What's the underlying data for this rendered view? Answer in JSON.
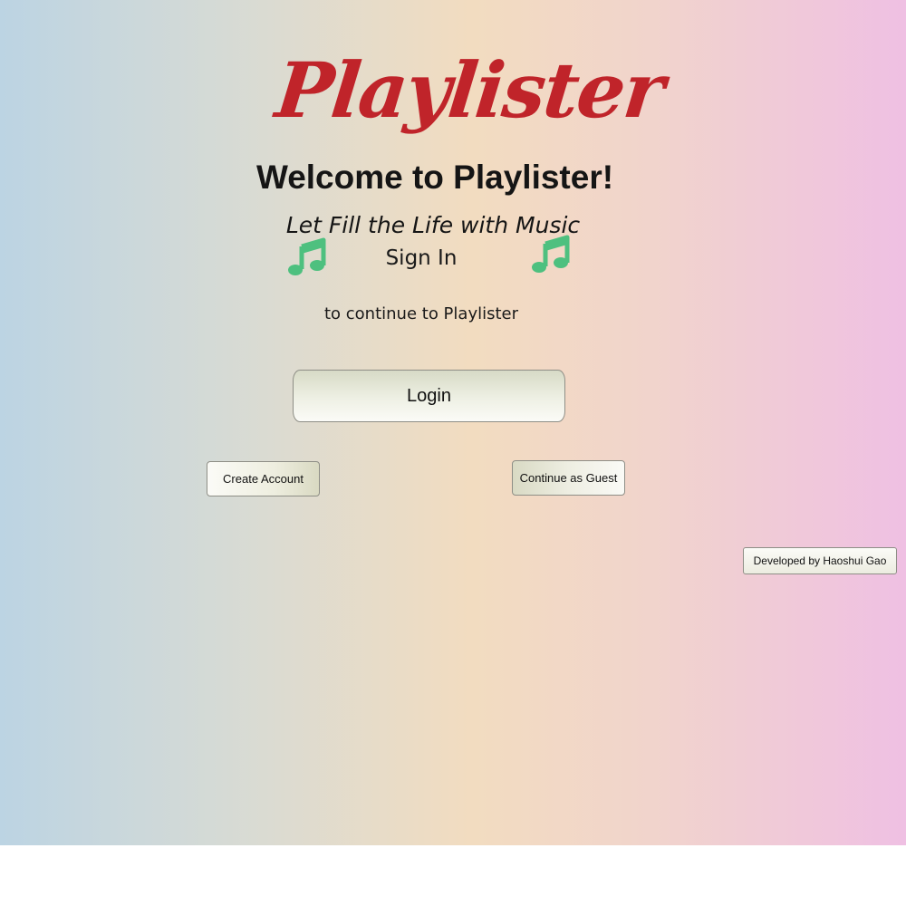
{
  "app": {
    "logo_text": "Playlister",
    "welcome_title": "Welcome to Playlister!",
    "tagline": "Let Fill the Life with Music",
    "sign_in_heading": "Sign In",
    "sign_in_subtext": "to continue to Playlister"
  },
  "actions": {
    "login_label": "Login",
    "create_account_label": "Create Account",
    "continue_guest_label": "Continue as Guest",
    "developer_label": "Developed by Haoshui Gao"
  },
  "icons": {
    "left": "music-note-icon",
    "right": "music-note-icon"
  },
  "colors": {
    "logo": "#c0242a",
    "note": "#4ec07f",
    "gradient": [
      "#bcd4e3",
      "#d9dbd3",
      "#f2dcc0",
      "#f1d4cc",
      "#efc0e3"
    ]
  }
}
